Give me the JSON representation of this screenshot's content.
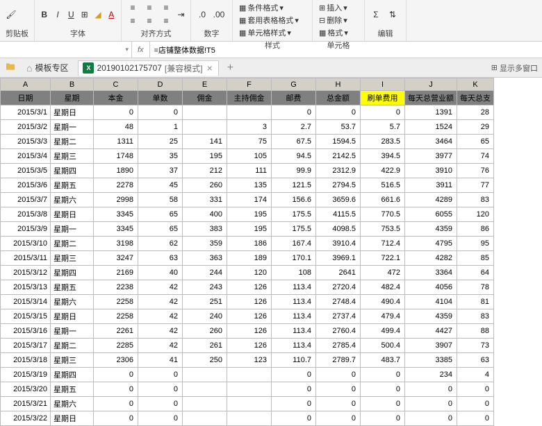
{
  "ribbon": {
    "groups": {
      "clipboard": "剪贴板",
      "font": "字体",
      "alignment": "对齐方式",
      "number": "数字",
      "styles": "样式",
      "cells": "单元格",
      "editing": "编辑"
    },
    "items": {
      "cond_format": "条件格式",
      "table_format": "套用表格格式",
      "cell_styles": "单元格样式",
      "insert": "插入",
      "delete": "删除",
      "format": "格式"
    }
  },
  "formula_bar": {
    "name_box": "",
    "fx": "fx",
    "formula": "=店铺整体数据!T5"
  },
  "tabs": {
    "template": "模板专区",
    "workbook": "20190102175707",
    "mode": "[兼容模式]",
    "show_multi": "显示多窗口"
  },
  "headers": {
    "cols": [
      "A",
      "B",
      "C",
      "D",
      "E",
      "F",
      "G",
      "H",
      "I",
      "J",
      "K"
    ],
    "labels": [
      "日期",
      "星期",
      "本金",
      "单数",
      "佣金",
      "主持佣金",
      "邮费",
      "总金额",
      "刷单费用",
      "每天总营业额",
      "每天总支"
    ]
  },
  "rows": [
    {
      "date": "2015/3/1",
      "day": "星期日",
      "c": "0",
      "d": "0",
      "e": "",
      "f": "",
      "g": "0",
      "h": "0",
      "i": "0",
      "j": "1391",
      "k": "28"
    },
    {
      "date": "2015/3/2",
      "day": "星期一",
      "c": "48",
      "d": "1",
      "e": "",
      "f": "3",
      "g": "2.7",
      "h": "53.7",
      "i": "5.7",
      "j": "1524",
      "k": "29"
    },
    {
      "date": "2015/3/3",
      "day": "星期二",
      "c": "1311",
      "d": "25",
      "e": "141",
      "f": "75",
      "g": "67.5",
      "h": "1594.5",
      "i": "283.5",
      "j": "3464",
      "k": "65"
    },
    {
      "date": "2015/3/4",
      "day": "星期三",
      "c": "1748",
      "d": "35",
      "e": "195",
      "f": "105",
      "g": "94.5",
      "h": "2142.5",
      "i": "394.5",
      "j": "3977",
      "k": "74"
    },
    {
      "date": "2015/3/5",
      "day": "星期四",
      "c": "1890",
      "d": "37",
      "e": "212",
      "f": "111",
      "g": "99.9",
      "h": "2312.9",
      "i": "422.9",
      "j": "3910",
      "k": "76"
    },
    {
      "date": "2015/3/6",
      "day": "星期五",
      "c": "2278",
      "d": "45",
      "e": "260",
      "f": "135",
      "g": "121.5",
      "h": "2794.5",
      "i": "516.5",
      "j": "3911",
      "k": "77"
    },
    {
      "date": "2015/3/7",
      "day": "星期六",
      "c": "2998",
      "d": "58",
      "e": "331",
      "f": "174",
      "g": "156.6",
      "h": "3659.6",
      "i": "661.6",
      "j": "4289",
      "k": "83"
    },
    {
      "date": "2015/3/8",
      "day": "星期日",
      "c": "3345",
      "d": "65",
      "e": "400",
      "f": "195",
      "g": "175.5",
      "h": "4115.5",
      "i": "770.5",
      "j": "6055",
      "k": "120"
    },
    {
      "date": "2015/3/9",
      "day": "星期一",
      "c": "3345",
      "d": "65",
      "e": "383",
      "f": "195",
      "g": "175.5",
      "h": "4098.5",
      "i": "753.5",
      "j": "4359",
      "k": "86"
    },
    {
      "date": "2015/3/10",
      "day": "星期二",
      "c": "3198",
      "d": "62",
      "e": "359",
      "f": "186",
      "g": "167.4",
      "h": "3910.4",
      "i": "712.4",
      "j": "4795",
      "k": "95"
    },
    {
      "date": "2015/3/11",
      "day": "星期三",
      "c": "3247",
      "d": "63",
      "e": "363",
      "f": "189",
      "g": "170.1",
      "h": "3969.1",
      "i": "722.1",
      "j": "4282",
      "k": "85"
    },
    {
      "date": "2015/3/12",
      "day": "星期四",
      "c": "2169",
      "d": "40",
      "e": "244",
      "f": "120",
      "g": "108",
      "h": "2641",
      "i": "472",
      "j": "3364",
      "k": "64"
    },
    {
      "date": "2015/3/13",
      "day": "星期五",
      "c": "2238",
      "d": "42",
      "e": "243",
      "f": "126",
      "g": "113.4",
      "h": "2720.4",
      "i": "482.4",
      "j": "4056",
      "k": "78"
    },
    {
      "date": "2015/3/14",
      "day": "星期六",
      "c": "2258",
      "d": "42",
      "e": "251",
      "f": "126",
      "g": "113.4",
      "h": "2748.4",
      "i": "490.4",
      "j": "4104",
      "k": "81"
    },
    {
      "date": "2015/3/15",
      "day": "星期日",
      "c": "2258",
      "d": "42",
      "e": "240",
      "f": "126",
      "g": "113.4",
      "h": "2737.4",
      "i": "479.4",
      "j": "4359",
      "k": "83"
    },
    {
      "date": "2015/3/16",
      "day": "星期一",
      "c": "2261",
      "d": "42",
      "e": "260",
      "f": "126",
      "g": "113.4",
      "h": "2760.4",
      "i": "499.4",
      "j": "4427",
      "k": "88"
    },
    {
      "date": "2015/3/17",
      "day": "星期二",
      "c": "2285",
      "d": "42",
      "e": "261",
      "f": "126",
      "g": "113.4",
      "h": "2785.4",
      "i": "500.4",
      "j": "3907",
      "k": "73"
    },
    {
      "date": "2015/3/18",
      "day": "星期三",
      "c": "2306",
      "d": "41",
      "e": "250",
      "f": "123",
      "g": "110.7",
      "h": "2789.7",
      "i": "483.7",
      "j": "3385",
      "k": "63"
    },
    {
      "date": "2015/3/19",
      "day": "星期四",
      "c": "0",
      "d": "0",
      "e": "",
      "f": "",
      "g": "0",
      "h": "0",
      "i": "0",
      "j": "234",
      "k": "4"
    },
    {
      "date": "2015/3/20",
      "day": "星期五",
      "c": "0",
      "d": "0",
      "e": "",
      "f": "",
      "g": "0",
      "h": "0",
      "i": "0",
      "j": "0",
      "k": "0"
    },
    {
      "date": "2015/3/21",
      "day": "星期六",
      "c": "0",
      "d": "0",
      "e": "",
      "f": "",
      "g": "0",
      "h": "0",
      "i": "0",
      "j": "0",
      "k": "0"
    },
    {
      "date": "2015/3/22",
      "day": "星期日",
      "c": "0",
      "d": "0",
      "e": "",
      "f": "",
      "g": "0",
      "h": "0",
      "i": "0",
      "j": "0",
      "k": "0"
    }
  ]
}
